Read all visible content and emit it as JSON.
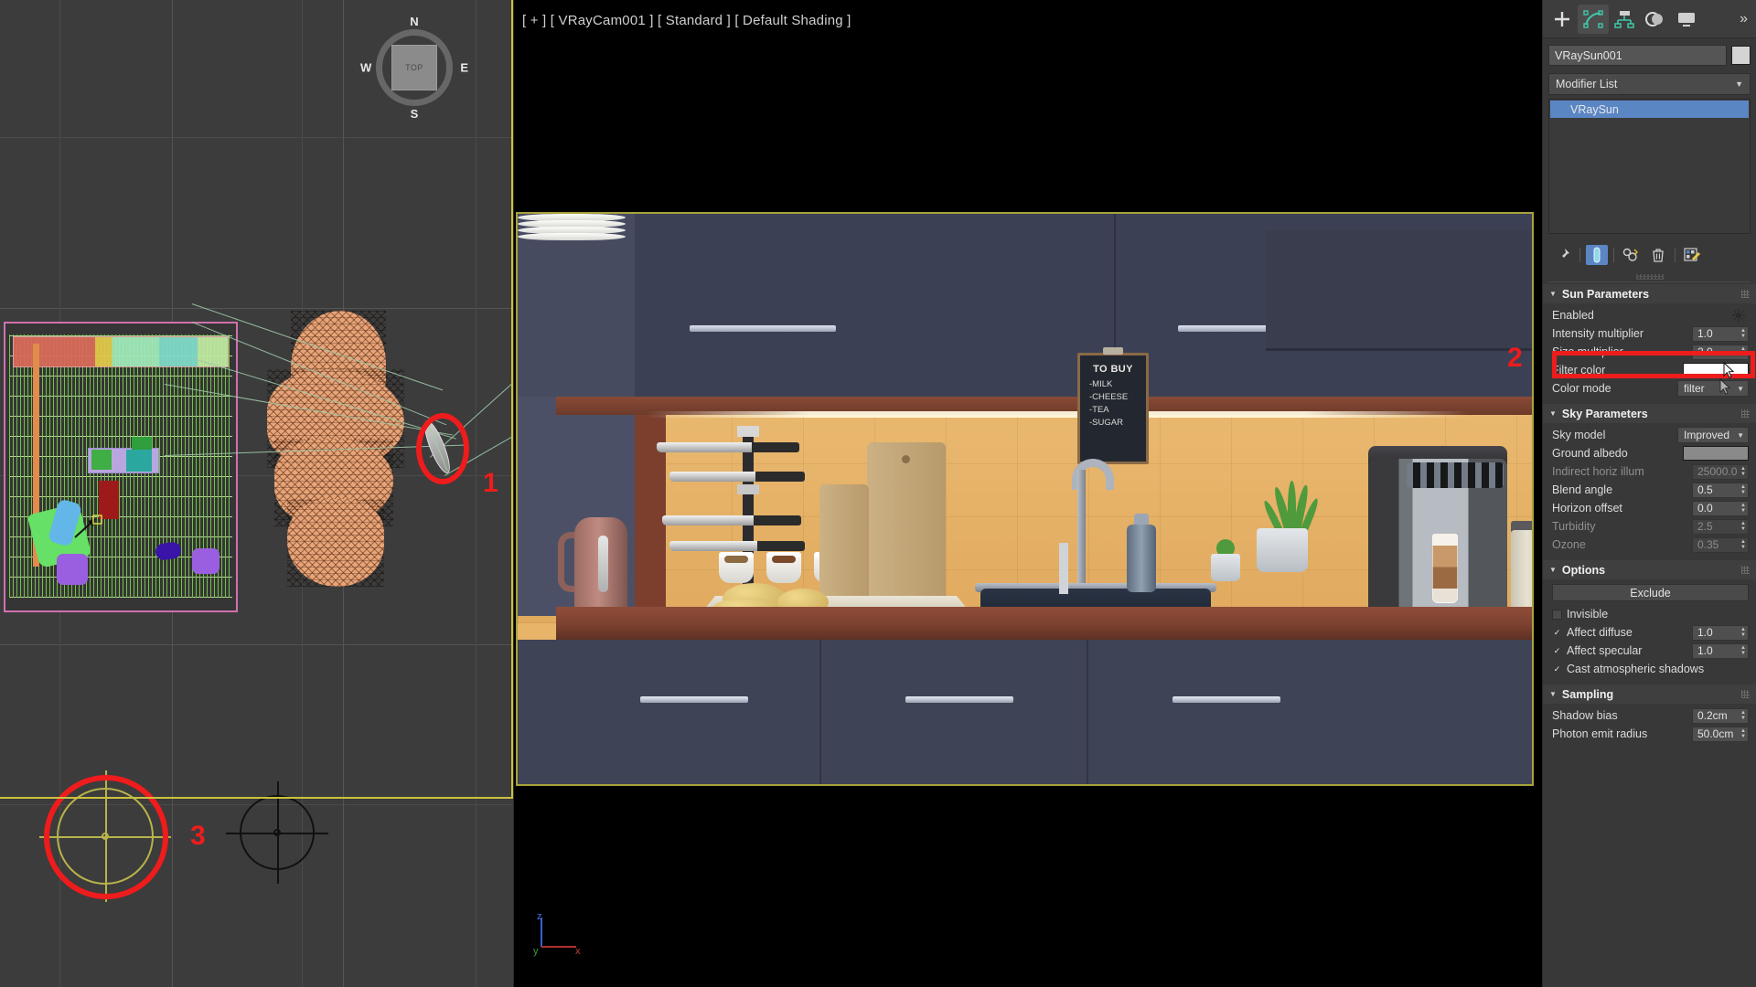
{
  "viewports": {
    "left": {
      "name": "top-orthographic-viewport",
      "viewcube": {
        "north": "N",
        "south": "S",
        "west": "W",
        "east": "E",
        "face": "TOP"
      }
    },
    "center": {
      "label": "[ + ] [ VRayCam001 ] [ Standard ] [ Default Shading ]",
      "axis_tripod": {
        "z": "z",
        "y": "y",
        "x": "x"
      }
    }
  },
  "render_scene": {
    "chalkboard": {
      "title": "TO BUY",
      "items": [
        "-MILK",
        "-CHEESE",
        "-TEA",
        "-SUGAR"
      ]
    }
  },
  "annotations": [
    {
      "number": "1",
      "shape": "ellipse",
      "target": "vraysun-object-in-viewport"
    },
    {
      "number": "2",
      "shape": "rectangle",
      "target": "sun-enabled-checkbox-row"
    },
    {
      "number": "3",
      "shape": "circle",
      "target": "compass-helper-gizmo"
    }
  ],
  "command_panel": {
    "tabs": [
      {
        "name": "create",
        "icon": "plus-icon",
        "active": false
      },
      {
        "name": "modify",
        "icon": "modify-icon",
        "active": true
      },
      {
        "name": "hierarchy",
        "icon": "hierarchy-icon",
        "active": false
      },
      {
        "name": "motion",
        "icon": "motion-icon",
        "active": false
      },
      {
        "name": "display",
        "icon": "display-icon",
        "active": false
      }
    ],
    "more_label": "»",
    "object_name": "VRaySun001",
    "modifier_list_label": "Modifier List",
    "modifier_stack": [
      {
        "label": "VRaySun",
        "selected": true
      }
    ],
    "stack_tools": [
      {
        "name": "pin-stack",
        "icon": "pin-icon"
      },
      {
        "name": "show-end-result",
        "icon": "show-end-result-icon",
        "active": true
      },
      {
        "name": "make-unique",
        "icon": "make-unique-icon"
      },
      {
        "name": "remove-modifier",
        "icon": "trash-icon"
      },
      {
        "name": "configure-modifier-sets",
        "icon": "configure-sets-icon"
      }
    ],
    "rollouts": [
      {
        "title": "Sun Parameters",
        "expanded": true,
        "rows": [
          {
            "label": "Enabled",
            "type": "checkbox",
            "checked": true,
            "highlighted": true
          },
          {
            "label": "Intensity multiplier",
            "type": "spinner",
            "value": "1.0",
            "enabled": true
          },
          {
            "label": "Size multiplier",
            "type": "spinner",
            "value": "2.0",
            "enabled": true
          },
          {
            "label": "Filter color",
            "type": "colorswatch",
            "color": "#ffffff"
          },
          {
            "label": "Color mode",
            "type": "combo",
            "value": "filter"
          }
        ]
      },
      {
        "title": "Sky Parameters",
        "expanded": true,
        "rows": [
          {
            "label": "Sky model",
            "type": "combo",
            "value": "Improved"
          },
          {
            "label": "Ground albedo",
            "type": "colorswatch",
            "color": "#8a8a8a"
          },
          {
            "label": "Indirect horiz illum",
            "type": "spinner",
            "value": "25000.0",
            "enabled": false
          },
          {
            "label": "Blend angle",
            "type": "spinner",
            "value": "0.5",
            "enabled": true
          },
          {
            "label": "Horizon offset",
            "type": "spinner",
            "value": "0.0",
            "enabled": true
          },
          {
            "label": "Turbidity",
            "type": "spinner",
            "value": "2.5",
            "enabled": false
          },
          {
            "label": "Ozone",
            "type": "spinner",
            "value": "0.35",
            "enabled": false
          }
        ]
      },
      {
        "title": "Options",
        "expanded": true,
        "rows": [
          {
            "label": "Exclude",
            "type": "button"
          },
          {
            "label": "Invisible",
            "type": "checkbox",
            "checked": false
          },
          {
            "label": "Affect diffuse",
            "type": "checkbox_spinner",
            "checked": true,
            "value": "1.0"
          },
          {
            "label": "Affect specular",
            "type": "checkbox_spinner",
            "checked": true,
            "value": "1.0"
          },
          {
            "label": "Cast atmospheric shadows",
            "type": "checkbox",
            "checked": true
          }
        ]
      },
      {
        "title": "Sampling",
        "expanded": true,
        "rows": [
          {
            "label": "Shadow bias",
            "type": "spinner",
            "value": "0.2cm",
            "enabled": true
          },
          {
            "label": "Photon emit radius",
            "type": "spinner",
            "value": "50.0cm",
            "enabled": true
          }
        ]
      }
    ]
  },
  "colors": {
    "annotation_red": "#ee1c1c",
    "selection_blue": "#5b86c4",
    "active_viewport_border": "#c9c23f",
    "selected_object_orange": "#e8a477",
    "helper_yellow": "#b7b34a"
  }
}
